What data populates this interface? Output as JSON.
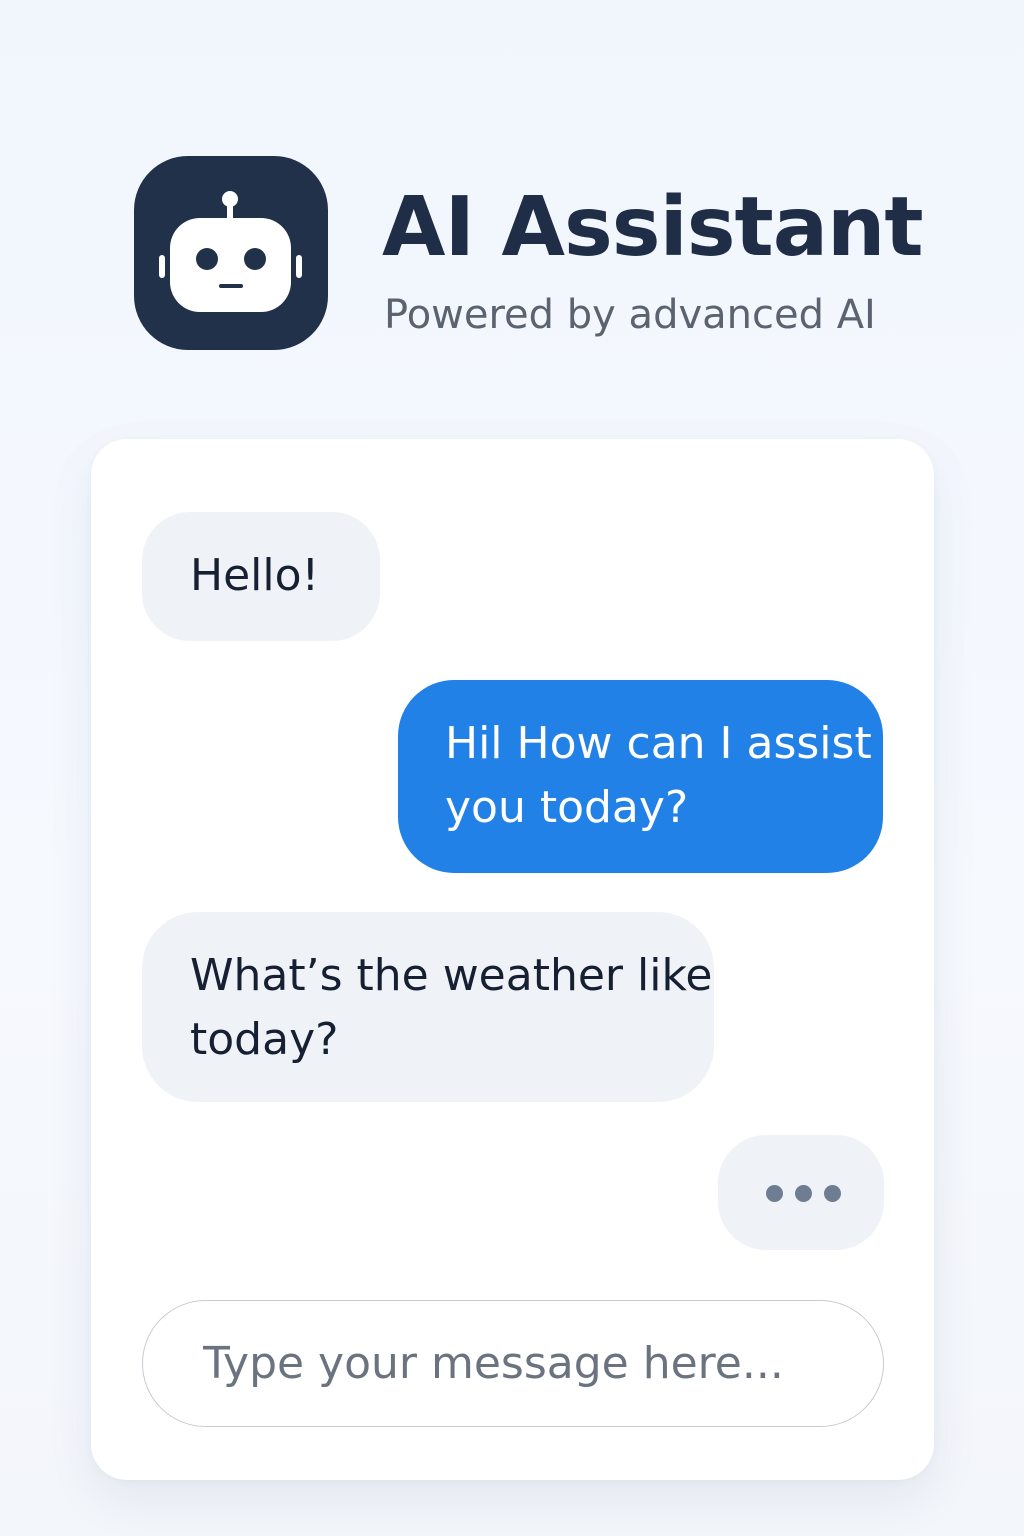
{
  "header": {
    "title": "AI Assistant",
    "subtitle": "Powered by advanced AI",
    "logo_icon": "robot-icon"
  },
  "messages": [
    {
      "role": "incoming",
      "text": "Hello!"
    },
    {
      "role": "outgoing",
      "text": "Hil How can I assist you today?"
    },
    {
      "role": "incoming",
      "text": "What’s the weather like today?"
    }
  ],
  "typing_indicator": {
    "role": "outgoing",
    "icon": "ellipsis-icon"
  },
  "input": {
    "placeholder": "Type your message here...",
    "value": ""
  },
  "colors": {
    "background": "#f3f7fd",
    "logo_bg": "#22314a",
    "title": "#1f2d46",
    "incoming_bubble": "#eff3f8",
    "outgoing_bubble": "#2281e6",
    "typing_dots": "#6f7d93"
  }
}
